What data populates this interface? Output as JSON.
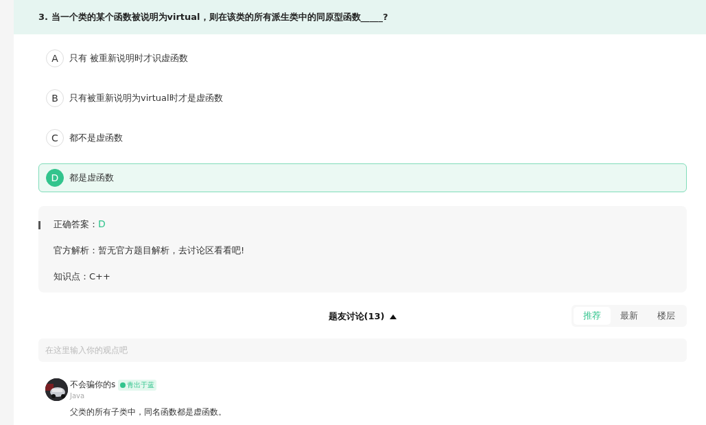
{
  "question": {
    "text": "3. 当一个类的某个函数被说明为virtual，则在该类的所有派生类中的同原型函数_____?"
  },
  "options": [
    {
      "letter": "A",
      "text": "只有 被重新说明时才识虚函数",
      "selected": false
    },
    {
      "letter": "B",
      "text": "只有被重新说明为virtual时才是虚函数",
      "selected": false
    },
    {
      "letter": "C",
      "text": "都不是虚函数",
      "selected": false
    },
    {
      "letter": "D",
      "text": "都是虚函数",
      "selected": true
    }
  ],
  "analysis": {
    "answer_label": "正确答案：",
    "answer": "D",
    "explanation": "官方解析：暂无官方题目解析，去讨论区看看吧!",
    "knowledge": "知识点：C++"
  },
  "discussion": {
    "title": "题友讨论(13)",
    "expanded": true,
    "sort_tabs": [
      {
        "label": "推荐",
        "selected": true
      },
      {
        "label": "最新",
        "selected": false
      },
      {
        "label": "楼层",
        "selected": false
      }
    ],
    "input": {
      "placeholder": "在这里输入你的观点吧"
    },
    "comments": [
      {
        "user": "不会骗你的s",
        "badge": "青出于蓝",
        "tag": "Java",
        "text": "父类的所有子类中，同名函数都是虚函数。"
      }
    ]
  }
}
